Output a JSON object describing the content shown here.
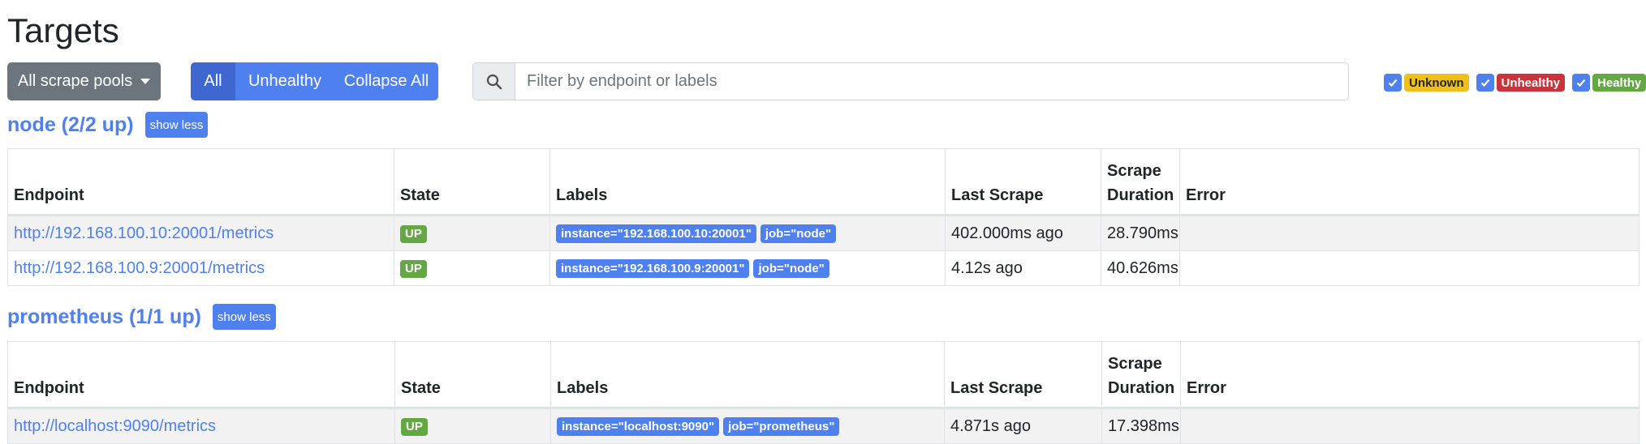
{
  "page": {
    "title": "Targets"
  },
  "toolbar": {
    "pool_select_label": "All scrape pools",
    "buttons": [
      "All",
      "Unhealthy",
      "Collapse All"
    ],
    "active_button": "All",
    "search_placeholder": "Filter by endpoint or labels",
    "search_value": ""
  },
  "filters": [
    {
      "label": "Unknown",
      "checked": true,
      "color": "#f0bf1c"
    },
    {
      "label": "Unhealthy",
      "checked": true,
      "color": "#c93339"
    },
    {
      "label": "Healthy",
      "checked": true,
      "color": "#64a843"
    }
  ],
  "columns": {
    "endpoint": "Endpoint",
    "state": "State",
    "labels": "Labels",
    "last_scrape_1": "Last",
    "last_scrape_2": "Scrape",
    "scrape_duration_1": "Scrape",
    "scrape_duration_2": "Duration",
    "error": "Error"
  },
  "pools": [
    {
      "title": "node (2/2 up)",
      "toggle_label": "show less",
      "rows": [
        {
          "endpoint": "http://192.168.100.10:20001/metrics",
          "state": "UP",
          "labels": [
            "instance=\"192.168.100.10:20001\"",
            "job=\"node\""
          ],
          "last_scrape": "402.000ms ago",
          "duration": "28.790ms",
          "error": ""
        },
        {
          "endpoint": "http://192.168.100.9:20001/metrics",
          "state": "UP",
          "labels": [
            "instance=\"192.168.100.9:20001\"",
            "job=\"node\""
          ],
          "last_scrape": "4.12s ago",
          "duration": "40.626ms",
          "error": ""
        }
      ]
    },
    {
      "title": "prometheus (1/1 up)",
      "toggle_label": "show less",
      "rows": [
        {
          "endpoint": "http://localhost:9090/metrics",
          "state": "UP",
          "labels": [
            "instance=\"localhost:9090\"",
            "job=\"prometheus\""
          ],
          "last_scrape": "4.871s ago",
          "duration": "17.398ms",
          "error": ""
        }
      ]
    }
  ],
  "colors": {
    "primary": "#4f80f0",
    "primary_active": "#3e68d0",
    "secondary": "#6c757d",
    "up": "#64a843"
  }
}
